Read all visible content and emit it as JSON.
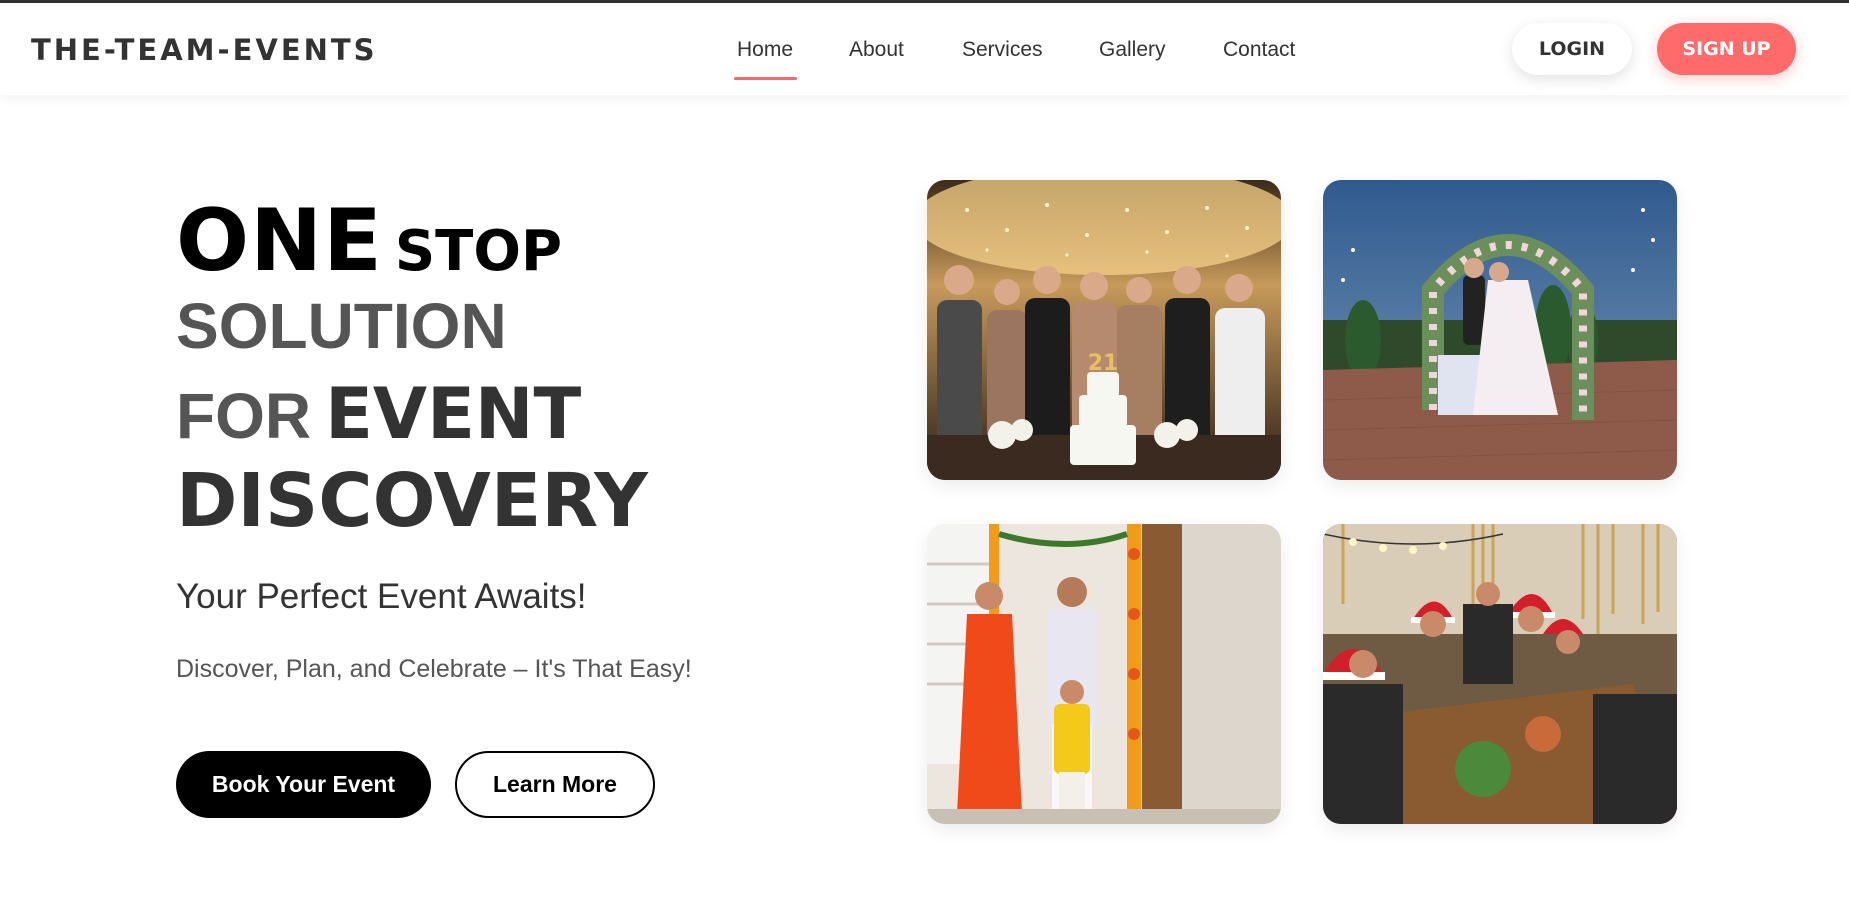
{
  "header": {
    "logo": "THE-TEAM-EVENTS",
    "nav": [
      {
        "label": "Home",
        "active": true
      },
      {
        "label": "About",
        "active": false
      },
      {
        "label": "Services",
        "active": false
      },
      {
        "label": "Gallery",
        "active": false
      },
      {
        "label": "Contact",
        "active": false
      }
    ],
    "login_label": "LOGIN",
    "signup_label": "SIGN UP"
  },
  "hero": {
    "title": {
      "one": "ONE",
      "stop": "STOP",
      "solution": "SOLUTION",
      "for": "FOR",
      "event": "EVENT",
      "discovery": "DISCOVERY"
    },
    "subtitle": "Your Perfect Event Awaits!",
    "tagline": "Discover, Plan, and Celebrate – It's That Easy!",
    "primary_button": "Book Your Event",
    "secondary_button": "Learn More"
  },
  "gallery": {
    "photos": [
      {
        "name": "party-toast-photo",
        "cake_number": "21"
      },
      {
        "name": "wedding-arch-photo"
      },
      {
        "name": "family-festival-photo"
      },
      {
        "name": "christmas-dinner-photo"
      }
    ]
  },
  "colors": {
    "accent": "#ff6b6b",
    "underline": "#f06b6b",
    "primary_button": "#000000",
    "text": "#333333"
  }
}
